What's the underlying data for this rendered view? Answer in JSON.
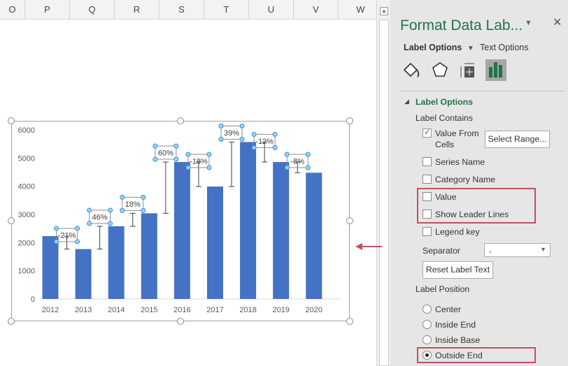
{
  "sheet": {
    "columns": [
      "O",
      "P",
      "Q",
      "R",
      "S",
      "T",
      "U",
      "V",
      "W"
    ]
  },
  "chart_data": {
    "type": "bar",
    "categories": [
      "2012",
      "2013",
      "2014",
      "2015",
      "2016",
      "2017",
      "2018",
      "2019",
      "2020"
    ],
    "values": [
      2230,
      1770,
      2580,
      3040,
      4860,
      3990,
      5570,
      4860,
      4480
    ],
    "change_labels": [
      "-21%",
      "46%",
      "18%",
      "60%",
      "-18%",
      "39%",
      "-12%",
      "-8%"
    ],
    "ylim": [
      0,
      6000
    ],
    "yticks": [
      "0",
      "1000",
      "2000",
      "3000",
      "4000",
      "5000",
      "6000"
    ],
    "bar_color": "#4472c4",
    "grid": false,
    "legend": "none"
  },
  "panel": {
    "title": "Format Data Lab...",
    "tab_label_options": "Label Options",
    "tab_text_options": "Text Options",
    "icons": [
      "fill-line-icon",
      "effects-icon",
      "size-properties-icon",
      "label-options-icon"
    ],
    "section": "Label Options",
    "label_contains": "Label Contains",
    "checkboxes": [
      {
        "label": "Value From Cells",
        "checked": true
      },
      {
        "label": "Series Name",
        "checked": false
      },
      {
        "label": "Category Name",
        "checked": false
      },
      {
        "label": "Value",
        "checked": false
      },
      {
        "label": "Show Leader Lines",
        "checked": false
      },
      {
        "label": "Legend key",
        "checked": false
      }
    ],
    "value_from_line1": "Value From",
    "value_from_line2": "Cells",
    "select_range": "Select Range...",
    "separator_label": "Separator",
    "separator_value": ",",
    "reset": "Reset Label Text",
    "label_position": "Label Position",
    "positions": [
      {
        "label": "Center",
        "selected": false
      },
      {
        "label": "Inside End",
        "selected": false
      },
      {
        "label": "Inside Base",
        "selected": false
      },
      {
        "label": "Outside End",
        "selected": true
      }
    ],
    "accent": "#217346",
    "highlight": "#c0505c"
  }
}
